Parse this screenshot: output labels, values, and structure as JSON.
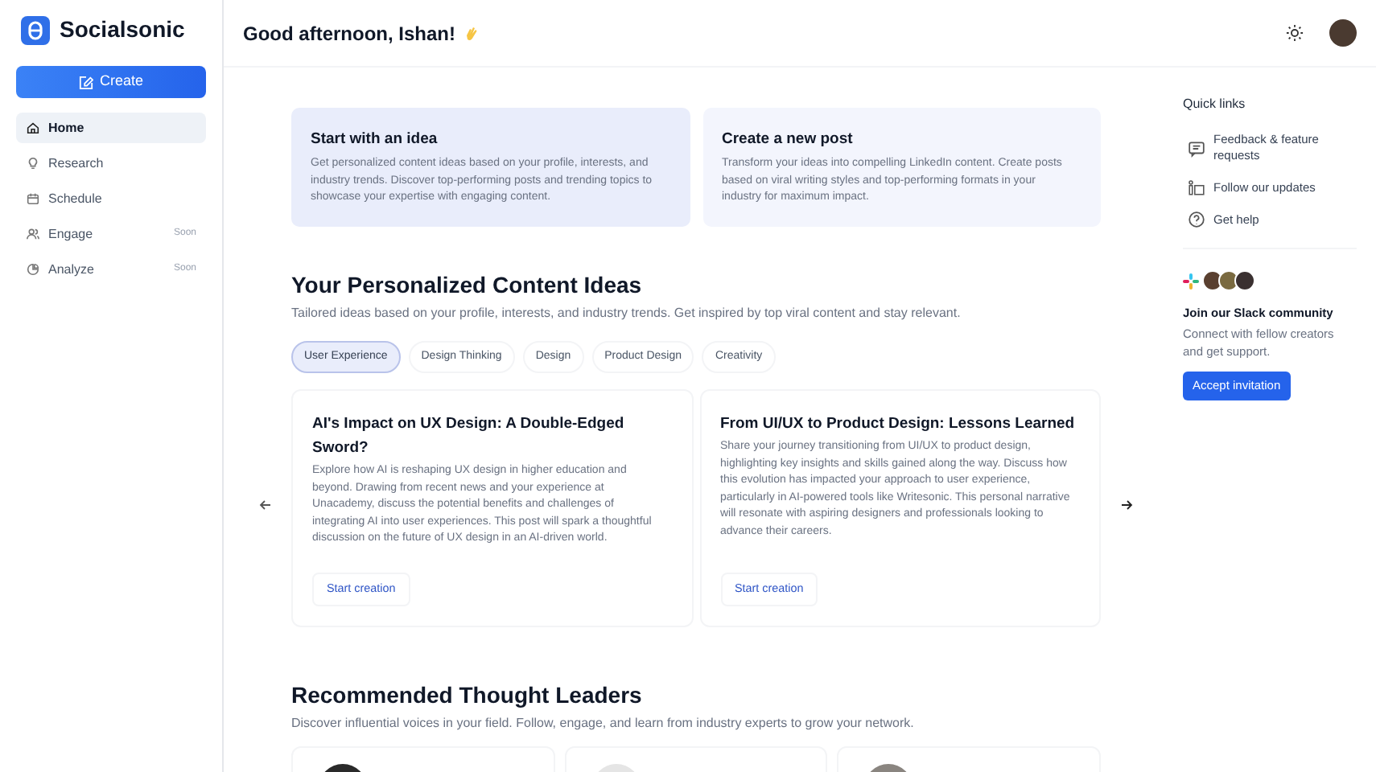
{
  "brand": {
    "name": "Socialsonic"
  },
  "create_button": "Create",
  "nav": [
    {
      "label": "Home",
      "selected": true
    },
    {
      "label": "Research",
      "selected": false
    },
    {
      "label": "Schedule",
      "selected": false
    },
    {
      "label": "Engage",
      "selected": false,
      "badge": "Soon"
    },
    {
      "label": "Analyze",
      "selected": false,
      "badge": "Soon"
    }
  ],
  "greeting": "Good afternoon, Ishan!",
  "start_cards": [
    {
      "title": "Start with an idea",
      "text": "Get personalized content ideas based on your profile, interests, and industry trends. Discover top-performing posts and trending topics to showcase your expertise with engaging content."
    },
    {
      "title": "Create a new post",
      "text": "Transform your ideas into compelling LinkedIn content. Create posts based on viral writing styles and top-performing formats in your industry for maximum impact."
    }
  ],
  "ideas": {
    "title": "Your Personalized Content Ideas",
    "subtitle": "Tailored ideas based on your profile, interests, and industry trends. Get inspired by top viral content and stay relevant.",
    "tabs": [
      {
        "label": "User Experience",
        "selected": true
      },
      {
        "label": "Design Thinking",
        "selected": false
      },
      {
        "label": "Design",
        "selected": false
      },
      {
        "label": "Product Design",
        "selected": false
      },
      {
        "label": "Creativity",
        "selected": false
      }
    ],
    "cards": [
      {
        "title": "AI's Impact on UX Design: A Double-Edged Sword?",
        "text": "Explore how AI is reshaping UX design in higher education and beyond. Drawing from recent news and your experience at Unacademy, discuss the potential benefits and challenges of integrating AI into user experiences. This post will spark a thoughtful discussion on the future of UX design in an AI-driven world.",
        "button": "Start creation"
      },
      {
        "title": "From UI/UX to Product Design: Lessons Learned",
        "text": "Share your journey transitioning from UI/UX to product design, highlighting key insights and skills gained along the way. Discuss how this evolution has impacted your approach to user experience, particularly in AI-powered tools like Writesonic. This personal narrative will resonate with aspiring designers and professionals looking to advance their careers.",
        "button": "Start creation"
      }
    ]
  },
  "leaders": {
    "title": "Recommended Thought Leaders",
    "subtitle": "Discover influential voices in your field. Follow, engage, and learn from industry experts to grow your network."
  },
  "quick_links": {
    "title": "Quick links",
    "items": [
      {
        "label": "Feedback & feature requests"
      },
      {
        "label": "Follow our updates"
      },
      {
        "label": "Get help"
      }
    ]
  },
  "slack": {
    "title": "Join our Slack community",
    "text": "Connect with fellow creators and get support.",
    "button": "Accept invitation"
  }
}
